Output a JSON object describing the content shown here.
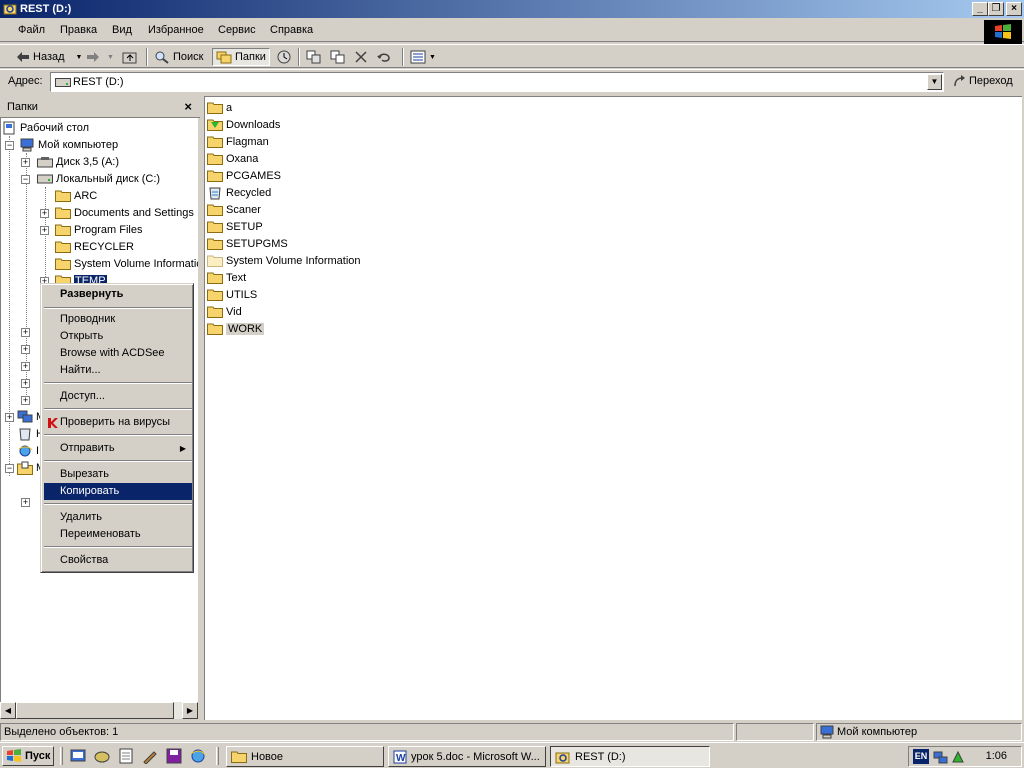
{
  "window": {
    "title": "REST (D:)"
  },
  "menu": [
    "Файл",
    "Правка",
    "Вид",
    "Избранное",
    "Сервис",
    "Справка"
  ],
  "toolbar": {
    "back": "Назад",
    "search": "Поиск",
    "folders": "Папки"
  },
  "address": {
    "label": "Адрес:",
    "value": "REST (D:)",
    "go": "Переход"
  },
  "folders_pane": {
    "title": "Папки",
    "close": "×",
    "tree": [
      "Рабочий стол",
      "Мой компьютер",
      "Диск 3,5 (A:)",
      "Локальный диск (C:)",
      "ARC",
      "Documents and Settings",
      "Program Files",
      "RECYCLER",
      "System Volume Informatic",
      "TEMP"
    ],
    "partial": [
      "M",
      "H",
      "I",
      "M"
    ]
  },
  "files": [
    "a",
    "Downloads",
    "Flagman",
    "Oxana",
    "PCGAMES",
    "Recycled",
    "Scaner",
    "SETUP",
    "SETUPGMS",
    "System Volume Information",
    "Text",
    "UTILS",
    "Vid",
    "WORK"
  ],
  "context_menu": {
    "expand": "Развернуть",
    "explorer": "Проводник",
    "open": "Открыть",
    "acdsee": "Browse with ACDSee",
    "find": "Найти...",
    "sharing": "Доступ...",
    "virus": "Проверить на вирусы",
    "send": "Отправить",
    "cut": "Вырезать",
    "copy": "Копировать",
    "delete": "Удалить",
    "rename": "Переименовать",
    "properties": "Свойства"
  },
  "statusbar": {
    "selected": "Выделено объектов: 1",
    "location": "Мой компьютер"
  },
  "taskbar": {
    "start": "Пуск",
    "tasks": [
      "Новое",
      "урок 5.doc - Microsoft W...",
      "REST (D:)"
    ],
    "lang": "EN",
    "clock": "1:06"
  }
}
